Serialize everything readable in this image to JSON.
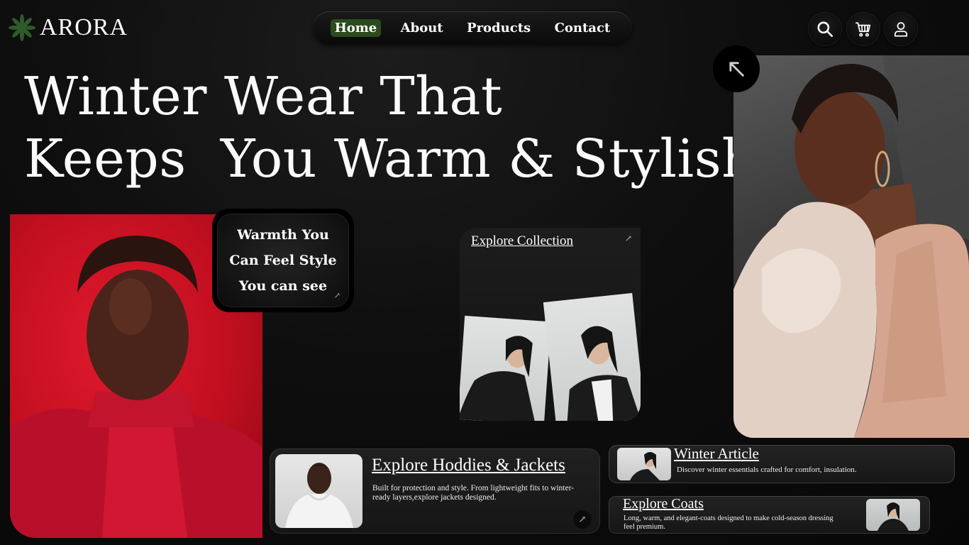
{
  "brand": {
    "name": "ARORA",
    "accent": "#2d4a1f",
    "logo_icon": "flower-icon",
    "logo_color": "#2f5a2a"
  },
  "nav": {
    "items": [
      {
        "label": "Home",
        "active": true
      },
      {
        "label": "About",
        "active": false
      },
      {
        "label": "Products",
        "active": false
      },
      {
        "label": "Contact",
        "active": false
      }
    ]
  },
  "actions": {
    "icons": [
      "search-icon",
      "cart-icon",
      "user-icon"
    ]
  },
  "hero": {
    "headline_line1": "Winter Wear That",
    "headline_line2": "Keeps  You Warm & Stylish",
    "corner_icon": "arrow-up-left-icon"
  },
  "warmth_card": {
    "line1": "Warmth You",
    "line2": "Can Feel Style",
    "line3": "You can see",
    "icon": "arrow-up-right-icon"
  },
  "collection_card": {
    "title": "Explore Collection",
    "icon": "arrow-up-right-icon"
  },
  "hoodie_card": {
    "title": "Explore Hoddies & Jackets",
    "description": "Built for protection and style. From lightweight fits to winter-ready layers,explore jackets  designed.",
    "icon": "arrow-up-right-icon"
  },
  "article_card": {
    "title": "Winter Article",
    "description": "Discover winter essentials crafted for comfort, insulation."
  },
  "coats_card": {
    "title": "Explore Coats",
    "description": "Long, warm, and elegant-coats designed to make cold-season dressing feel premium."
  }
}
